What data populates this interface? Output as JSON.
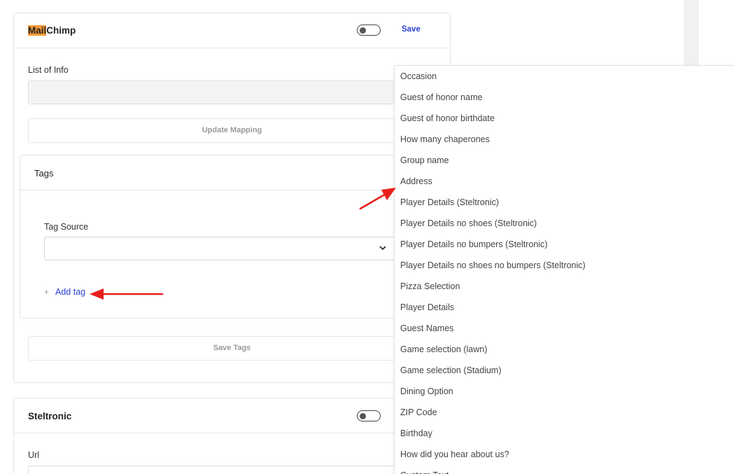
{
  "mailchimp": {
    "title_highlight": "Mail",
    "title_rest": "Chimp",
    "save_label": "Save",
    "list_label": "List of Info",
    "list_value": "",
    "update_mapping_label": "Update Mapping",
    "tags": {
      "title": "Tags",
      "tag_source_label": "Tag Source",
      "tag_source_value": "",
      "add_tag_label": "Add tag",
      "plus_glyph": "+"
    },
    "save_tags_label": "Save Tags"
  },
  "steltronic": {
    "title": "Steltronic",
    "url_label": "Url"
  },
  "dropdown": {
    "items": [
      "Occasion",
      "Guest of honor name",
      "Guest of honor birthdate",
      "How many chaperones",
      "Group name",
      "Address",
      "Player Details (Steltronic)",
      "Player Details no shoes (Steltronic)",
      "Player Details no bumpers (Steltronic)",
      "Player Details no shoes no bumpers (Steltronic)",
      "Pizza Selection",
      "Player Details",
      "Guest Names",
      "Game selection (lawn)",
      "Game selection (Stadium)",
      "Dining Option",
      "ZIP Code",
      "Birthday",
      "How did you hear about us?",
      "Custom Text"
    ]
  },
  "colors": {
    "accent": "#2a3fd6",
    "highlight": "#f39a36",
    "arrow": "#e8201c"
  },
  "icons": {
    "select_chevron": "chevron-down-icon",
    "annotation_arrows": "red-arrow-icon"
  }
}
